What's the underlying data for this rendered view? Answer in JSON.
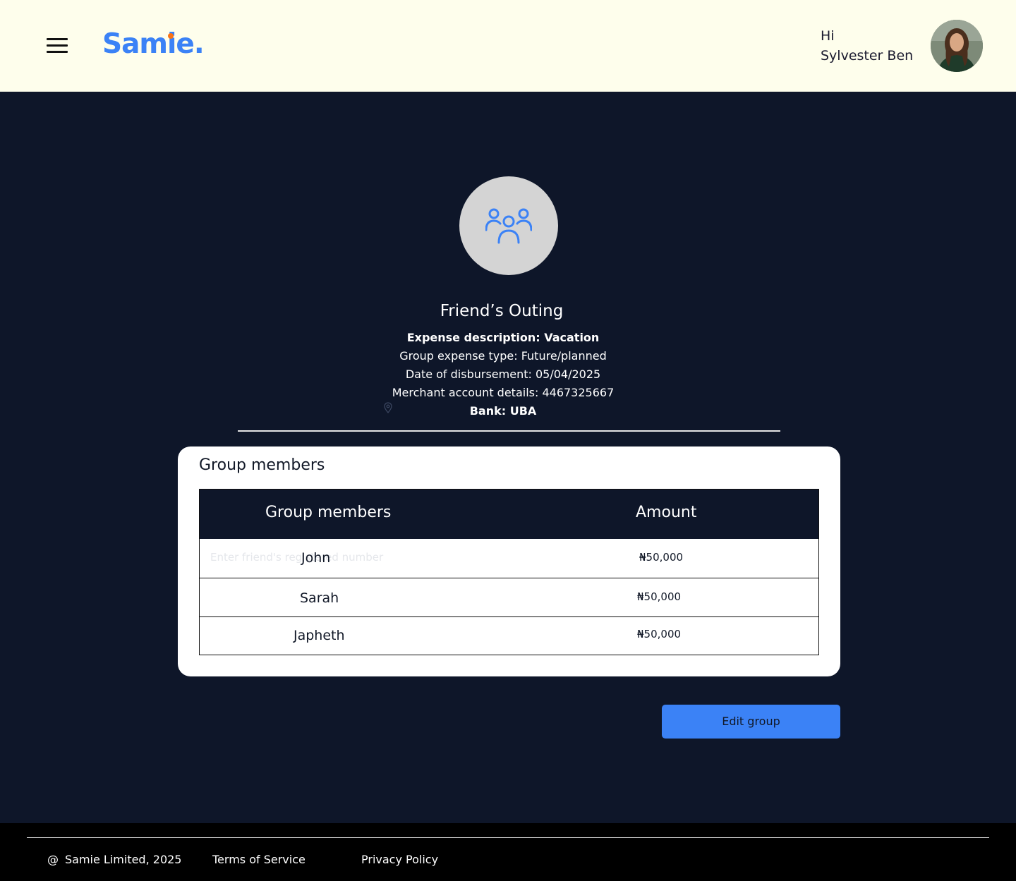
{
  "header": {
    "logo": "Samie.",
    "greeting_line1": "Hi",
    "greeting_line2": "Sylvester Ben"
  },
  "group": {
    "title": "Friend’s Outing",
    "expense_description": "Expense description: Vacation",
    "expense_type": "Group expense type: Future/planned",
    "disbursement_date": "Date of disbursement: 05/04/2025",
    "merchant_account": "Merchant account details: 4467325667",
    "bank": "Bank: UBA"
  },
  "members_card": {
    "title": "Group members",
    "columns": [
      "Group members",
      "Amount"
    ],
    "placeholder": "Enter friend's registered number",
    "rows": [
      {
        "name": "John",
        "amount": "₦50,000"
      },
      {
        "name": "Sarah",
        "amount": "₦50,000"
      },
      {
        "name": "Japheth",
        "amount": "₦50,000"
      }
    ]
  },
  "actions": {
    "edit_label": "Edit group"
  },
  "footer": {
    "copyright_symbol": "@",
    "copyright": "Samie Limited, 2025",
    "terms": "Terms of Service",
    "privacy": "Privacy Policy"
  },
  "colors": {
    "brand": "#3b82f6",
    "accent_dot": "#f97316",
    "page_bg": "#0e1629",
    "header_bg": "#fefeec"
  }
}
